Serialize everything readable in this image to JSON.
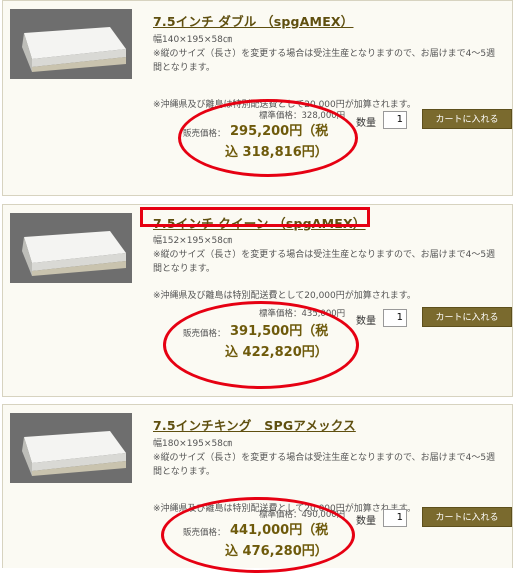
{
  "products": [
    {
      "title": "7.5インチ ダブル （spgAMEX）",
      "size": "幅140×195×58㎝",
      "desc": "※縦のサイズ（長さ）を変更する場合は受注生産となりますので、お届けまで4～5週間となります。",
      "note": "※沖縄県及び離島は特別配送費として20,000円が加算されます。",
      "std_price": "標準価格：328,000円",
      "sale_label": "販売価格：",
      "sale_price_line1": "295,200円（税",
      "sale_price_line2": "込 318,816円）",
      "qty_label": "数量",
      "qty_value": "1",
      "cart_label": "カートに入れる"
    },
    {
      "title": "7.5インチ クイーン （spgAMEX）",
      "size": "幅152×195×58㎝",
      "desc": "※縦のサイズ（長さ）を変更する場合は受注生産となりますので、お届けまで4～5週間となります。",
      "note": "※沖縄県及び離島は特別配送費として20,000円が加算されます。",
      "std_price": "標準価格：435,000円",
      "sale_label": "販売価格：",
      "sale_price_line1": "391,500円（税",
      "sale_price_line2": "込 422,820円）",
      "qty_label": "数量",
      "qty_value": "1",
      "cart_label": "カートに入れる"
    },
    {
      "title": "7.5インチキング　SPGアメックス",
      "size": "幅180×195×58㎝",
      "desc": "※縦のサイズ（長さ）を変更する場合は受注生産となりますので、お届けまで4～5週間となります。",
      "note": "※沖縄県及び離島は特別配送費として20,000円が加算されます。",
      "std_price": "標準価格：490,000円",
      "sale_label": "販売価格：",
      "sale_price_line1": "441,000円（税",
      "sale_price_line2": "込 476,280円）",
      "qty_label": "数量",
      "qty_value": "1",
      "cart_label": "カートに入れる"
    }
  ],
  "colors": {
    "title": "#5f4f0f",
    "price": "#6e5a0b",
    "button": "#7a6a2e",
    "highlight": "#e60012"
  }
}
